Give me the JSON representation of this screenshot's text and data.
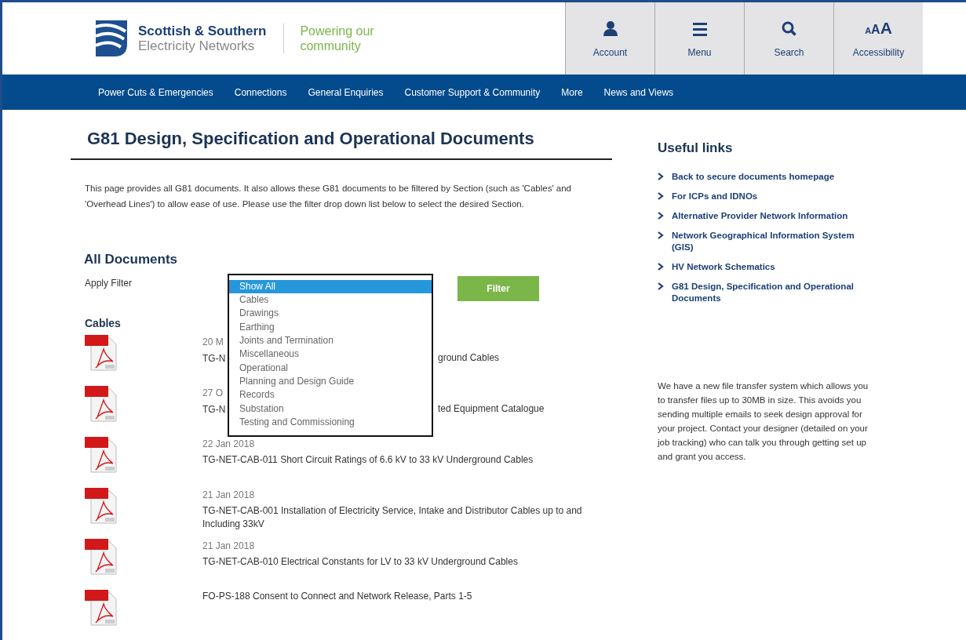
{
  "header": {
    "logo": {
      "line1": "Scottish & Southern",
      "line2": "Electricity Networks"
    },
    "tagline": {
      "line1": "Powering our",
      "line2": "community"
    },
    "tools": [
      {
        "kind": "person",
        "label": "Account"
      },
      {
        "kind": "bars",
        "label": "Menu"
      },
      {
        "kind": "search",
        "label": "Search"
      },
      {
        "kind": "letters",
        "glyph": "AAA",
        "label": "Accessibility"
      }
    ]
  },
  "nav": [
    "Power Cuts & Emergencies",
    "Connections",
    "General Enquiries",
    "Customer Support & Community",
    "More",
    "News and Views"
  ],
  "main": {
    "title": "G81 Design, Specification and Operational Documents",
    "intro": "This page provides all G81 documents. It also allows these G81 documents to be filtered by Section (such as 'Cables' and 'Overhead Lines') to allow ease of use. Please use the filter drop down list below to select the desired Section.",
    "section_heading": "All Documents",
    "filter": {
      "label": "Apply Filter",
      "button": "Filter",
      "options": [
        {
          "label": "Show All",
          "selected": true
        },
        {
          "label": "Cables",
          "selected": false
        },
        {
          "label": "Drawings",
          "selected": false
        },
        {
          "label": "Earthing",
          "selected": false
        },
        {
          "label": "Joints and Termination",
          "selected": false
        },
        {
          "label": "Miscellaneous",
          "selected": false
        },
        {
          "label": "Operational",
          "selected": false
        },
        {
          "label": "Planning and Design Guide",
          "selected": false
        },
        {
          "label": "Records",
          "selected": false
        },
        {
          "label": "Substation",
          "selected": false
        },
        {
          "label": "Testing and Commissioning",
          "selected": false
        }
      ]
    },
    "groups": [
      {
        "heading": "Cables",
        "documents": [
          {
            "date": "20 M",
            "title_parts": [
              "TG-N",
              "ground Cables"
            ]
          },
          {
            "date": "27 O",
            "title_parts": [
              "TG-N",
              "ted Equipment Catalogue"
            ]
          },
          {
            "date": "22 Jan 2018",
            "title_parts": [
              "TG-NET-CAB-011 Short Circuit Ratings of 6.6 kV to 33 kV Underground Cables"
            ]
          },
          {
            "date": "21 Jan 2018",
            "title_parts": [
              "TG-NET-CAB-001 Installation of Electricity Service, Intake and Distributor Cables up to and Including 33kV"
            ]
          },
          {
            "date": "21 Jan 2018",
            "title_parts": [
              "TG-NET-CAB-010 Electrical Constants for LV to 33 kV Underground Cables"
            ]
          },
          {
            "title_parts": [
              "FO-PS-188 Consent to Connect and Network Release, Parts 1-5"
            ]
          }
        ]
      }
    ]
  },
  "sidebar": {
    "heading": "Useful links",
    "links": [
      "Back to secure documents homepage",
      "For ICPs and IDNOs",
      "Alternative Provider Network Information",
      "Network Geographical Information System (GIS)",
      "HV Network Schematics",
      "G81 Design, Specification and Operational Documents"
    ],
    "note": "We have a new file transfer system which allows you to transfer files up to 30MB in size. This avoids you sending multiple emails to seek design approval for your project. Contact your designer (detailed on your job tracking) who can talk you through getting set up and grant you access."
  }
}
